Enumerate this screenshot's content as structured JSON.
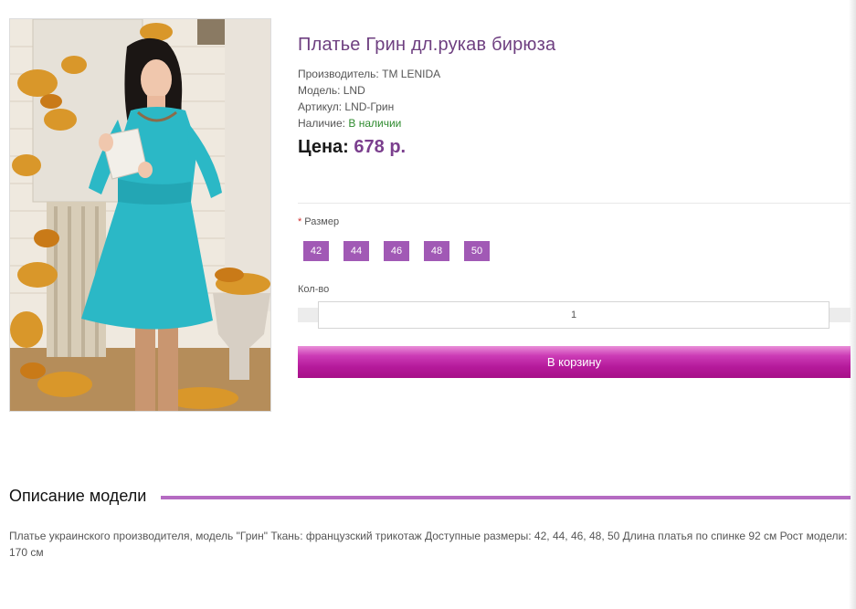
{
  "product": {
    "title": "Платье Грин дл.рукав бирюза",
    "manufacturer_label": "Производитель:",
    "manufacturer": "TM LENIDA",
    "model_label": "Модель:",
    "model": "LND",
    "sku_label": "Артикул:",
    "sku": "LND-Грин",
    "availability_label": "Наличие:",
    "availability": "В наличии",
    "price_label": "Цена:",
    "price": "678 р."
  },
  "options": {
    "size_required_mark": "*",
    "size_label": "Размер",
    "sizes": [
      "42",
      "44",
      "46",
      "48",
      "50"
    ],
    "qty_label": "Кол-во",
    "qty_value": "1",
    "add_to_cart": "В корзину"
  },
  "description": {
    "title": "Описание модели",
    "text": "Платье украинского производителя, модель \"Грин\" Ткань: французский трикотаж Доступные размеры: 42, 44, 46, 48, 50 Длина платья по спинке 92 см Рост модели: 170 см"
  },
  "colors": {
    "accent": "#a159b5",
    "title": "#6e3f80",
    "in_stock": "#2e8b2e",
    "cart_button": "#b51a9b"
  }
}
